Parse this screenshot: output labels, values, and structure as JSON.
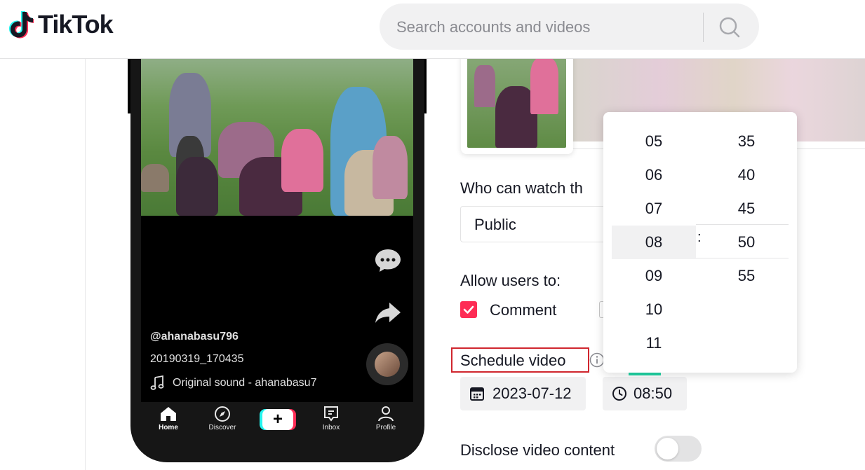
{
  "header": {
    "brand": "TikTok",
    "search_placeholder": "Search accounts and videos"
  },
  "preview": {
    "username": "@ahanabasu796",
    "title": "20190319_170435",
    "sound": "Original sound - ahanabasu7",
    "tabs": [
      {
        "label": "Home",
        "icon": "home-icon"
      },
      {
        "label": "Discover",
        "icon": "compass-icon"
      },
      {
        "label": "",
        "icon": "plus-icon"
      },
      {
        "label": "Inbox",
        "icon": "inbox-icon"
      },
      {
        "label": "Profile",
        "icon": "profile-icon"
      }
    ],
    "create_symbol": "+"
  },
  "settings": {
    "who_can_watch_label": "Who can watch th",
    "privacy_value": "Public",
    "allow_label": "Allow users to:",
    "comment_label": "Comment",
    "schedule_label": "Schedule video",
    "date_value": "2023-07-12",
    "time_value": "08:50",
    "disclose_label": "Disclose video content",
    "disclose_on": false
  },
  "time_picker": {
    "hours": [
      "05",
      "06",
      "07",
      "08",
      "09",
      "10",
      "11"
    ],
    "minutes": [
      "35",
      "40",
      "45",
      "50",
      "55"
    ],
    "selected_hour": "08",
    "selected_minute": "50",
    "separator": ":"
  },
  "colors": {
    "accent": "#fe2c55",
    "cyan": "#25f4ee",
    "highlight_border": "#d0262e"
  }
}
